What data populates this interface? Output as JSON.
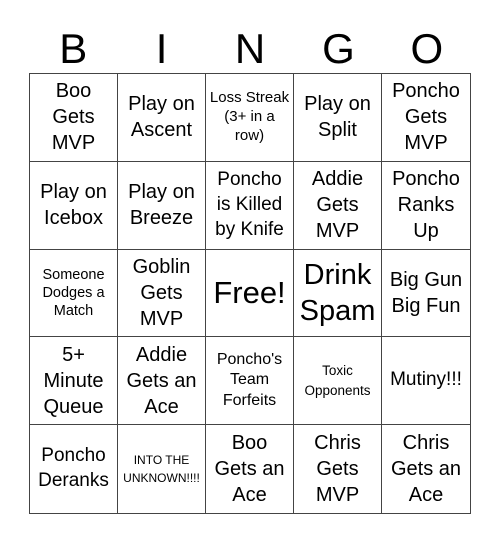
{
  "header": [
    "B",
    "I",
    "N",
    "G",
    "O"
  ],
  "cells": [
    "Boo Gets MVP",
    "Play on Ascent",
    "Loss Streak (3+ in a row)",
    "Play on Split",
    "Poncho Gets MVP",
    "Play on Icebox",
    "Play on Breeze",
    "Poncho is Killed by Knife",
    "Addie Gets MVP",
    "Poncho Ranks Up",
    "Someone Dodges a Match",
    "Goblin Gets MVP",
    "Free!",
    "Drink Spam",
    "Big Gun Big Fun",
    "5+ Minute Queue",
    "Addie Gets an Ace",
    "Poncho's Team Forfeits",
    "Toxic Opponents",
    "Mutiny!!!",
    "Poncho Deranks",
    "INTO THE UNKNOWN!!!!",
    "Boo Gets an Ace",
    "Chris Gets MVP",
    "Chris Gets an Ace"
  ]
}
